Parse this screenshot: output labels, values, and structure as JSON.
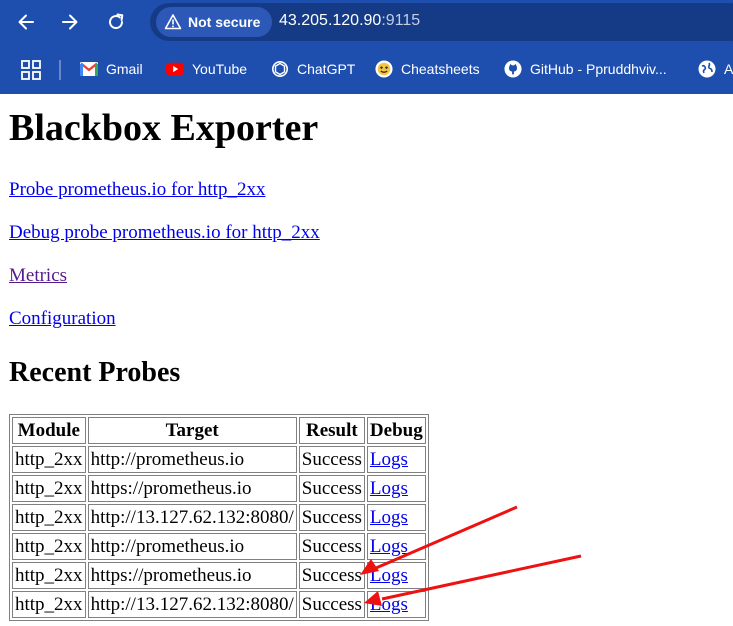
{
  "browser": {
    "security_label": "Not secure",
    "url_host": "43.205.120.90",
    "url_port": ":9115",
    "bookmarks": [
      {
        "label": "Gmail",
        "icon": "gmail-icon"
      },
      {
        "label": "YouTube",
        "icon": "youtube-icon"
      },
      {
        "label": "ChatGPT",
        "icon": "chatgpt-icon"
      },
      {
        "label": "Cheatsheets",
        "icon": "cheatsheets-icon"
      },
      {
        "label": "GitHub - Ppruddhviv...",
        "icon": "github-icon"
      },
      {
        "label": "A",
        "icon": "globe-icon"
      }
    ],
    "colors": {
      "chrome": "#1f4fae",
      "omnibox": "#163b86"
    }
  },
  "page": {
    "title": "Blackbox Exporter",
    "links": [
      "Probe prometheus.io for http_2xx",
      "Debug probe prometheus.io for http_2xx",
      "Metrics",
      "Configuration"
    ],
    "recent_title": "Recent Probes",
    "table": {
      "headers": [
        "Module",
        "Target",
        "Result",
        "Debug"
      ],
      "rows": [
        {
          "module": "http_2xx",
          "target": "http://prometheus.io",
          "result": "Success",
          "debug": "Logs"
        },
        {
          "module": "http_2xx",
          "target": "https://prometheus.io",
          "result": "Success",
          "debug": "Logs"
        },
        {
          "module": "http_2xx",
          "target": "http://13.127.62.132:8080/",
          "result": "Success",
          "debug": "Logs"
        },
        {
          "module": "http_2xx",
          "target": "http://prometheus.io",
          "result": "Success",
          "debug": "Logs"
        },
        {
          "module": "http_2xx",
          "target": "https://prometheus.io",
          "result": "Success",
          "debug": "Logs"
        },
        {
          "module": "http_2xx",
          "target": "http://13.127.62.132:8080/",
          "result": "Success",
          "debug": "Logs"
        }
      ]
    },
    "annotation_color": "#ee1111"
  }
}
